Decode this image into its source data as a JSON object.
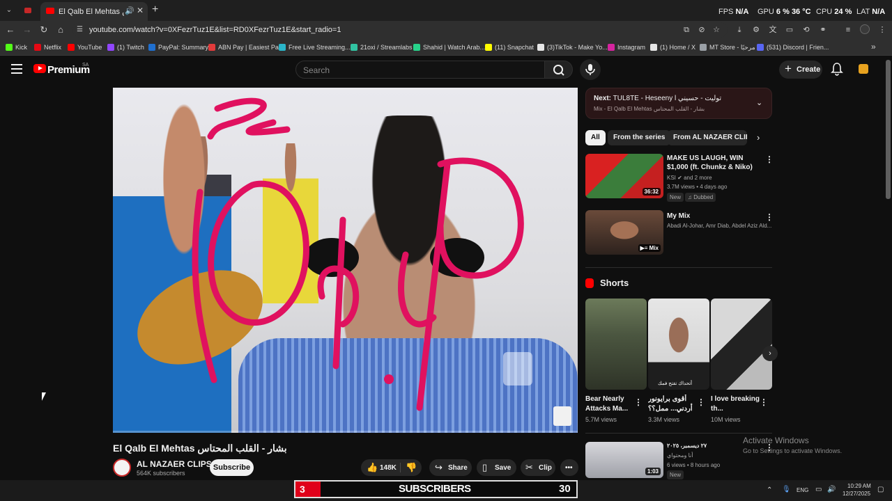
{
  "browser": {
    "tab": {
      "title": "El Qalb El Mehtas المحتاس",
      "speaker_icon": "speaker-icon"
    },
    "perf": {
      "fps_label": "FPS",
      "fps_value": "N/A",
      "gpu_label": "GPU",
      "gpu_value": "6 %",
      "gpu_temp": "36 °C",
      "cpu_label": "CPU",
      "cpu_value": "24 %",
      "lat_label": "LAT",
      "lat_value": "N/A"
    },
    "url": "youtube.com/watch?v=0XFezrTuz1E&list=RD0XFezrTuz1E&start_radio=1",
    "bookmarks": [
      {
        "label": "Kick",
        "color": "#53fc18"
      },
      {
        "label": "Netflix",
        "color": "#e50914"
      },
      {
        "label": "YouTube",
        "color": "#ff0000"
      },
      {
        "label": "(1) Twitch",
        "color": "#9146ff"
      },
      {
        "label": "PayPal: Summary",
        "color": "#1f6fcf"
      },
      {
        "label": "ABN Pay | Easiest Pa...",
        "color": "#e23b3b"
      },
      {
        "label": "Free Live Streaming...",
        "color": "#2ab5c9"
      },
      {
        "label": "21oxi / Streamlabs",
        "color": "#31c3a2"
      },
      {
        "label": "Shahid | Watch Arab...",
        "color": "#27d28a"
      },
      {
        "label": "(11) Snapchat",
        "color": "#fffc00"
      },
      {
        "label": "(3)TikTok - Make Yo...",
        "color": "#e6e6e6"
      },
      {
        "label": "Instagram",
        "color": "#d6249f"
      },
      {
        "label": "(1) Home / X",
        "color": "#e6e6e6"
      },
      {
        "label": "MT Store - مرحبًا",
        "color": "#9aa0a6"
      },
      {
        "label": "(531) Discord | Frien...",
        "color": "#5865f2"
      }
    ]
  },
  "yt": {
    "logo_text": "Premium",
    "logo_sup": "SA",
    "search_placeholder": "Search",
    "create_label": "Create"
  },
  "video": {
    "title": "El Qalb El Mehtas بشار - القلب المحتاس",
    "channel": "AL NAZAER CLIPS",
    "subscribers": "564K subscribers",
    "subscribe_label": "Subscribe",
    "likes": "148K",
    "share_label": "Share",
    "save_label": "Save",
    "clip_label": "Clip",
    "progress": 0.0
  },
  "sidebar": {
    "next_prefix": "Next:",
    "next_title": "TUL8TE - Heseeny l توليت - حسيني",
    "next_subtitle": "Mix - El Qalb El Mehtas بشار - القلب المحتاس",
    "chips": [
      "All",
      "From the series",
      "From AL NAZAER CLIPS"
    ],
    "recs": [
      {
        "title": "MAKE US LAUGH, WIN $1,000 (ft. Chunkz & Niko)",
        "channel": "KSI",
        "channel_extra": "and 2 more",
        "meta": "3.7M views • 4 days ago",
        "duration": "36:32",
        "tags": [
          "New",
          "Dubbed"
        ]
      },
      {
        "title": "My Mix",
        "channel": "Abadi Al-Johar, Amr Diab, Abdel Aziz Ald...",
        "badge": "Mix"
      }
    ],
    "shorts_label": "Shorts",
    "shorts": [
      {
        "title": "Bear Nearly Attacks Ma...",
        "views": "5.7M views"
      },
      {
        "title": "أقوى برايونور أردني... ممل؟؟",
        "views": "3.3M views",
        "caption": "أتحداك تفتح فمك"
      },
      {
        "title": "I love breaking th...",
        "views": "10M views"
      }
    ],
    "rec3": {
      "title": "٢٧ ديسمبر، ٢٠٢٥",
      "channel": "أنا ومحتواي",
      "meta": "6 views • 8 hours ago",
      "tag": "New",
      "duration": "1:03"
    }
  },
  "windows": {
    "activate_title": "Activate Windows",
    "activate_sub": "Go to Settings to activate Windows.",
    "overlay_left": "3",
    "overlay_label": "SUBSCRIBERS",
    "overlay_right": "30",
    "lang": "ENG",
    "time": "10:29 AM",
    "date": "12/27/2025"
  }
}
